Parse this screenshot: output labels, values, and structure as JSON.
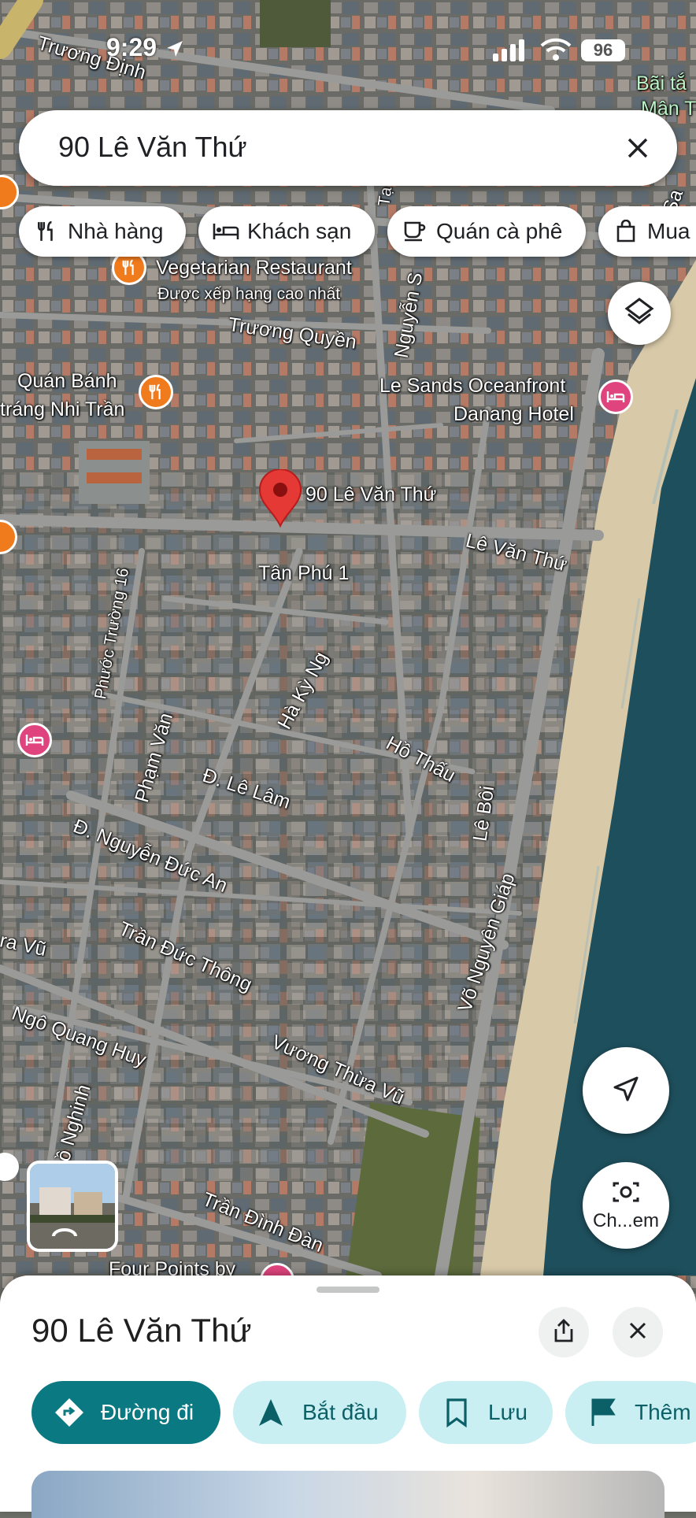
{
  "status_bar": {
    "time": "9:29",
    "battery": "96"
  },
  "search": {
    "query": "90 Lê Văn Thứ"
  },
  "chips": [
    {
      "label": "Nhà hàng",
      "icon": "restaurant-icon"
    },
    {
      "label": "Khách sạn",
      "icon": "hotel-icon"
    },
    {
      "label": "Quán cà phê",
      "icon": "coffee-icon"
    },
    {
      "label": "Mua",
      "icon": "shopping-bag-icon"
    }
  ],
  "map": {
    "pin_label": "90 Lê Văn Thứ",
    "streets": {
      "truong_dinh": "Trương Định",
      "truong_quyen": "Trương Quyền",
      "nguyen_s": "Nguyễn S",
      "ta": "Tạ",
      "le_van_thu": "Lê Văn Thứ",
      "tan_phu_1": "Tân Phú 1",
      "phuoc_truong_16": "Phước Trường 16",
      "ha_ky_ng": "Hà Kỳ Ng",
      "pham_van": "Phạm Văn",
      "ho_thau": "Hồ Thấu",
      "le_lam": "Đ. Lê Lâm",
      "le_boi": "Lê Bôi",
      "nguyen_duc_an": "Đ. Nguyễn Đức An",
      "ra_vu": "ra Vũ",
      "tran_duc_thong": "Trần Đức Thông",
      "vo_nguyen_giap": "Võ Nguyên Giáp",
      "ngo_quang_huy": "Ngô Quang Huy",
      "vuong_thua_vu": "Vương Thừa Vũ",
      "o_nghinh": "ồ Nghinh",
      "tran_dinh_dan": "Trần Đình Đàn",
      "sa": "Sa"
    },
    "places": {
      "vegetarian": "Vegetarian Restaurant",
      "vegetarian_sub": "Được xếp hạng cao nhất",
      "quan_banh_1": "Quán Bánh",
      "quan_banh_2": "tráng Nhi Trần",
      "le_sands_1": "Le Sands Oceanfront",
      "le_sands_2": "Danang Hotel",
      "bai_tam_1": "Bãi tắ",
      "bai_tam_2": "Mân Th",
      "four_points": "Four Points by"
    },
    "camera_label": "Ch...em"
  },
  "sheet": {
    "title": "90 Lê Văn Thứ",
    "actions": [
      {
        "label": "Đường đi",
        "icon": "directions-icon"
      },
      {
        "label": "Bắt đầu",
        "icon": "navigation-arrow-icon"
      },
      {
        "label": "Lưu",
        "icon": "bookmark-icon"
      },
      {
        "label": "Thêm",
        "icon": "flag-icon"
      }
    ]
  },
  "colors": {
    "primary": "#0b7982",
    "secondary_bg": "#c9eff2",
    "pin": "#e53935",
    "food_poi": "#f07b1d",
    "hotel_poi": "#e0447e",
    "sea": "#1e4f5c",
    "sand": "#d8c9a8"
  }
}
